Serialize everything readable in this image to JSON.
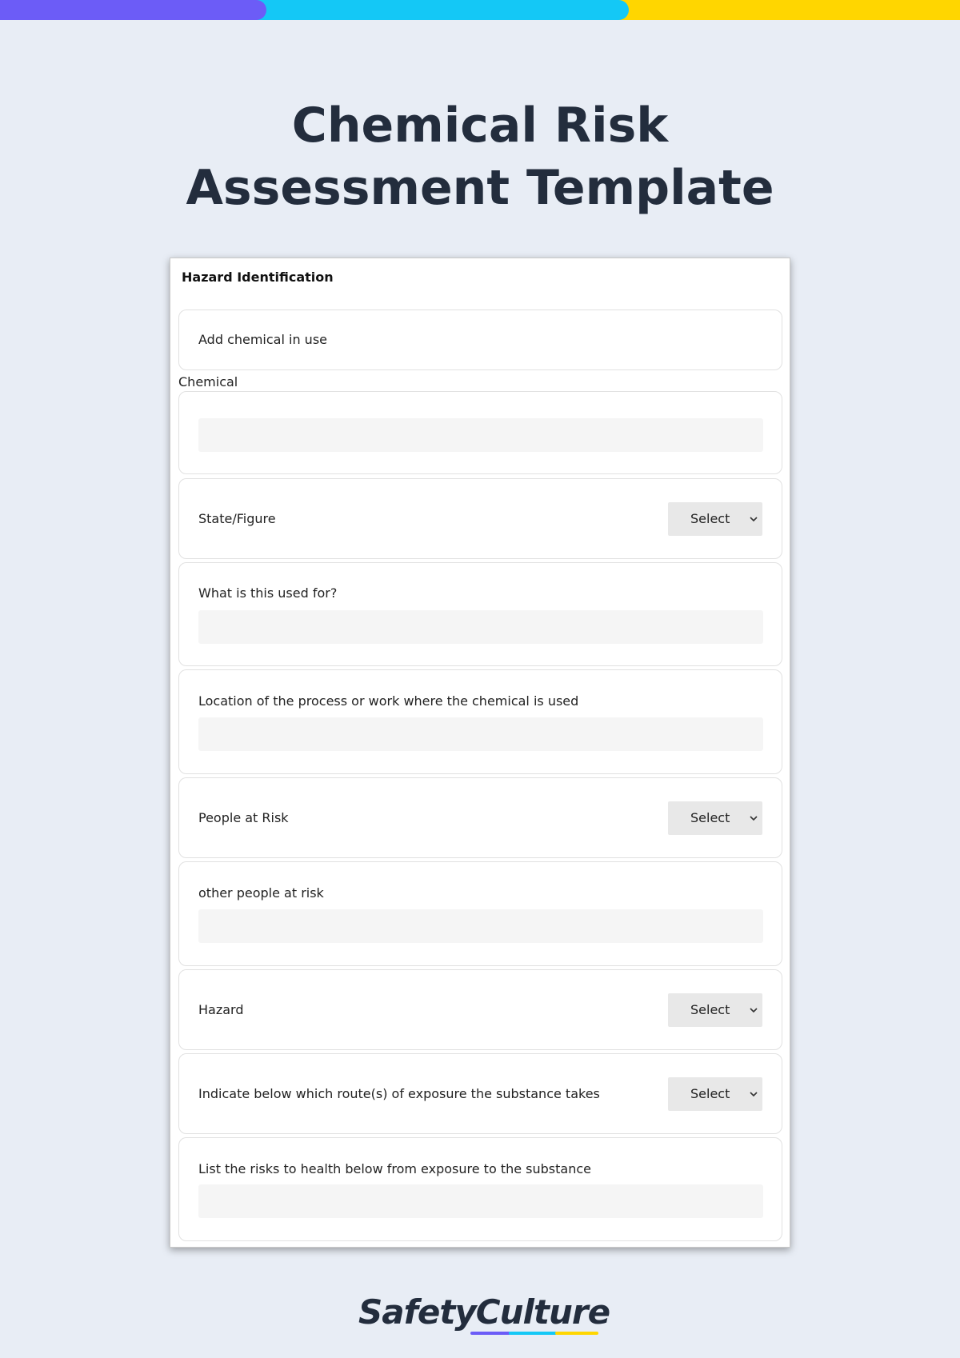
{
  "page": {
    "title_line1": "Chemical Risk",
    "title_line2": "Assessment Template"
  },
  "colors": {
    "background": "#e8edf5",
    "bar_purple": "#6c5cf7",
    "bar_cyan": "#14c8f6",
    "bar_yellow": "#ffd600",
    "title": "#232d3d"
  },
  "form": {
    "section_title": "Hazard Identification",
    "add_chemical_label": "Add chemical in use",
    "chemical_label": "Chemical",
    "chemical_value": "",
    "state_figure_label": "State/Figure",
    "state_figure_value": "Select",
    "used_for_label": "What is this used for?",
    "used_for_value": "",
    "location_label": "Location of the process or work where the chemical is used",
    "location_value": "",
    "people_at_risk_label": "People at Risk",
    "people_at_risk_value": "Select",
    "other_people_label": "other people at risk",
    "other_people_value": "",
    "hazard_label": "Hazard",
    "hazard_value": "Select",
    "route_label": "Indicate below which route(s) of exposure the substance takes",
    "route_value": "Select",
    "risks_label": "List the risks to health below from exposure to the substance",
    "risks_value": ""
  },
  "icons": {
    "select_chevron": "chevron-down-icon"
  },
  "brand": {
    "logo_text": "SafetyCulture"
  }
}
